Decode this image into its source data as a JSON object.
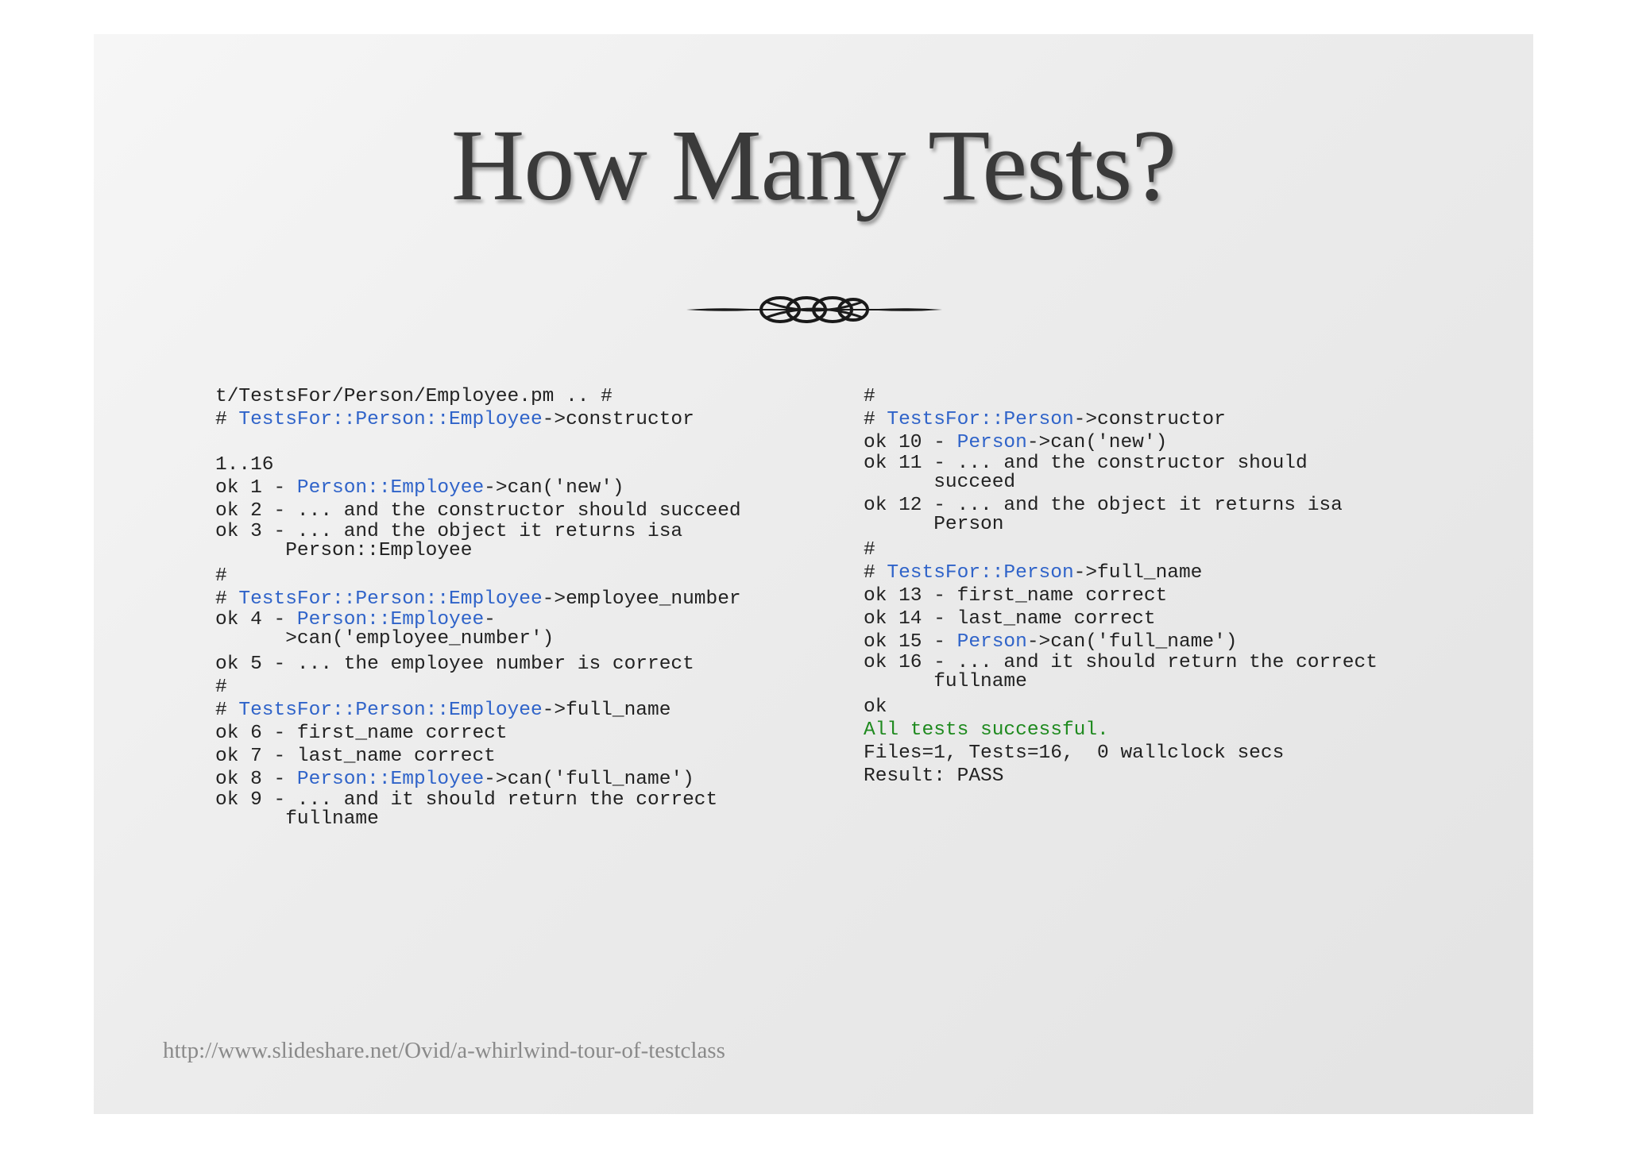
{
  "title": "How Many Tests?",
  "colors": {
    "text": "#222222",
    "package": "#2f63c9",
    "success": "#1f8a1f",
    "title": "#3a3a3a",
    "url": "#8a8a8a"
  },
  "left_column": {
    "lines": [
      {
        "segments": [
          {
            "text": "t/TestsFor/Person/Employee.pm .. #"
          }
        ]
      },
      {
        "segments": [
          {
            "text": "# "
          },
          {
            "text": "TestsFor::Person::Employee",
            "style": "blue"
          },
          {
            "text": "->constructor"
          }
        ]
      },
      {
        "segments": [
          {
            "text": ""
          }
        ],
        "gap": true
      },
      {
        "segments": [
          {
            "text": "1..16"
          }
        ]
      },
      {
        "segments": [
          {
            "text": "ok 1 - "
          },
          {
            "text": "Person::Employee",
            "style": "blue"
          },
          {
            "text": "->can('new')"
          }
        ]
      },
      {
        "segments": [
          {
            "text": "ok 2 - ... and the constructor should succeed"
          }
        ]
      },
      {
        "segments": [
          {
            "text": "ok 3 - ... and the object it returns isa"
          }
        ],
        "wrap_first": true
      },
      {
        "segments": [
          {
            "text": "      Person::Employee"
          }
        ],
        "wrap": true
      },
      {
        "segments": [
          {
            "text": "#"
          }
        ]
      },
      {
        "segments": [
          {
            "text": "# "
          },
          {
            "text": "TestsFor::Person::Employee",
            "style": "blue"
          },
          {
            "text": "->employee_number"
          }
        ]
      },
      {
        "segments": [
          {
            "text": "ok 4 - "
          },
          {
            "text": "Person::Employee",
            "style": "blue"
          },
          {
            "text": "-"
          }
        ],
        "wrap_first": true
      },
      {
        "segments": [
          {
            "text": "      >can('employee_number')"
          }
        ],
        "wrap": true
      },
      {
        "segments": [
          {
            "text": "ok 5 - ... the employee number is correct"
          }
        ]
      },
      {
        "segments": [
          {
            "text": "#"
          }
        ]
      },
      {
        "segments": [
          {
            "text": "# "
          },
          {
            "text": "TestsFor::Person::Employee",
            "style": "blue"
          },
          {
            "text": "->full_name"
          }
        ]
      },
      {
        "segments": [
          {
            "text": "ok 6 - first_name correct"
          }
        ]
      },
      {
        "segments": [
          {
            "text": "ok 7 - last_name correct"
          }
        ]
      },
      {
        "segments": [
          {
            "text": "ok 8 - "
          },
          {
            "text": "Person::Employee",
            "style": "blue"
          },
          {
            "text": "->can('full_name')"
          }
        ]
      },
      {
        "segments": [
          {
            "text": "ok 9 - ... and it should return the correct"
          }
        ],
        "wrap_first": true
      },
      {
        "segments": [
          {
            "text": "      fullname"
          }
        ],
        "wrap": true
      }
    ]
  },
  "right_column": {
    "lines": [
      {
        "segments": [
          {
            "text": "#"
          }
        ]
      },
      {
        "segments": [
          {
            "text": "# "
          },
          {
            "text": "TestsFor::Person",
            "style": "blue"
          },
          {
            "text": "->constructor"
          }
        ]
      },
      {
        "segments": [
          {
            "text": "ok 10 - "
          },
          {
            "text": "Person",
            "style": "blue"
          },
          {
            "text": "->can('new')"
          }
        ]
      },
      {
        "segments": [
          {
            "text": "ok 11 - ... and the constructor should"
          }
        ],
        "wrap_first": true
      },
      {
        "segments": [
          {
            "text": "      succeed"
          }
        ],
        "wrap": true
      },
      {
        "segments": [
          {
            "text": "ok 12 - ... and the object it returns isa"
          }
        ],
        "wrap_first": true
      },
      {
        "segments": [
          {
            "text": "      Person"
          }
        ],
        "wrap": true
      },
      {
        "segments": [
          {
            "text": "#"
          }
        ]
      },
      {
        "segments": [
          {
            "text": "# "
          },
          {
            "text": "TestsFor::Person",
            "style": "blue"
          },
          {
            "text": "->full_name"
          }
        ]
      },
      {
        "segments": [
          {
            "text": "ok 13 - first_name correct"
          }
        ]
      },
      {
        "segments": [
          {
            "text": "ok 14 - last_name correct"
          }
        ]
      },
      {
        "segments": [
          {
            "text": "ok 15 - "
          },
          {
            "text": "Person",
            "style": "blue"
          },
          {
            "text": "->can('full_name')"
          }
        ]
      },
      {
        "segments": [
          {
            "text": "ok 16 - ... and it should return the correct"
          }
        ],
        "wrap_first": true
      },
      {
        "segments": [
          {
            "text": "      fullname"
          }
        ],
        "wrap": true
      },
      {
        "segments": [
          {
            "text": "ok"
          }
        ]
      },
      {
        "segments": [
          {
            "text": "All tests successful.",
            "style": "green"
          }
        ]
      },
      {
        "segments": [
          {
            "text": "Files=1, Tests=16,  0 wallclock secs"
          }
        ]
      },
      {
        "segments": [
          {
            "text": "Result: PASS"
          }
        ]
      }
    ]
  },
  "source_url": "http://www.slideshare.net/Ovid/a-whirlwind-tour-of-testclass",
  "ornament_icon": "flourish-divider-icon"
}
